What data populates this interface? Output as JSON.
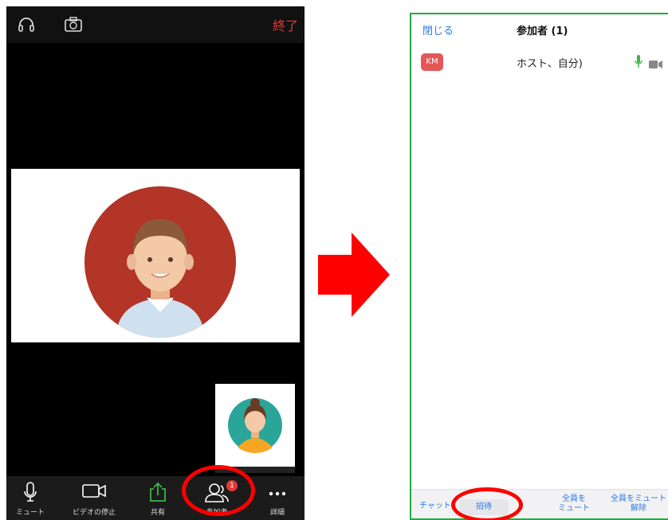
{
  "left_screen": {
    "end_label": "終了",
    "toolbar": {
      "mute": {
        "label": "ミュート",
        "icon": "microphone-icon"
      },
      "video": {
        "label": "ビデオの停止",
        "icon": "video-camera-icon"
      },
      "share": {
        "label": "共有",
        "icon": "share-upload-icon",
        "color": "#39b54a"
      },
      "participants": {
        "label": "参加者",
        "icon": "participants-icon",
        "badge": "1"
      },
      "more": {
        "label": "詳細",
        "icon": "more-dots-icon"
      }
    }
  },
  "right_screen": {
    "close_label": "閉じる",
    "title": "参加者 (1)",
    "participant": {
      "initials": "KM",
      "role_text": "ホスト、自分)",
      "avatar_color": "#e45757"
    },
    "footer": {
      "chat_label": "チャット",
      "invite_label": "招待",
      "mute_all_line1": "全員を",
      "mute_all_line2": "ミュート",
      "unmute_all_line1": "全員をミュート",
      "unmute_all_line2": "解除"
    }
  },
  "colors": {
    "highlight": "#ff0000",
    "arrow": "#ff0000",
    "accent": "#2c7be5",
    "frame": "#22aa44"
  }
}
